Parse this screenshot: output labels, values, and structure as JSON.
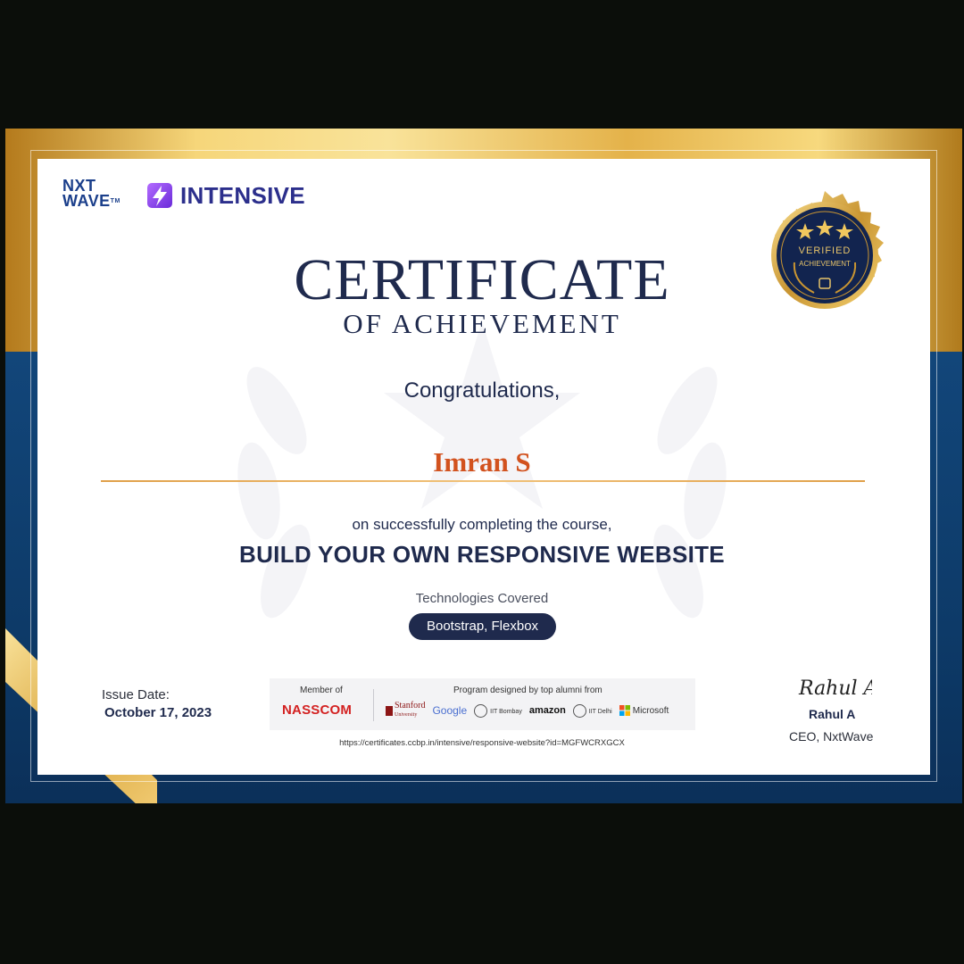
{
  "brand": {
    "nxt": "NXT",
    "wave": "WAVE",
    "tm": "TM",
    "program": "INTENSIVE"
  },
  "badge": {
    "line1": "VERIFIED",
    "line2": "ACHIEVEMENT"
  },
  "certificate": {
    "title": "CERTIFICATE",
    "subtitle": "OF ACHIEVEMENT",
    "greeting": "Congratulations,",
    "recipient": "Imran S",
    "completion_text": "on successfully completing the course,",
    "course": "BUILD YOUR OWN RESPONSIVE WEBSITE",
    "tech_label": "Technologies Covered",
    "technologies": "Bootstrap, Flexbox"
  },
  "issue": {
    "label": "Issue Date:",
    "date": "October 17, 2023"
  },
  "partners": {
    "member_label": "Member of",
    "member": "NASSCOM",
    "designed_label": "Program designed by top alumni from",
    "stanford": "Stanford",
    "stanford_sub": "University",
    "google": "Google",
    "iit_bombay": "IIT Bombay",
    "amazon": "amazon",
    "iit_delhi": "IIT Delhi",
    "microsoft": "Microsoft"
  },
  "verify_url": "https://certificates.ccbp.in/intensive/responsive-website?id=MGFWCRXGCX",
  "signatory": {
    "signature": "Rahul A",
    "name": "Rahul A",
    "role": "CEO, NxtWave"
  },
  "colors": {
    "navy": "#1f2a4d",
    "accent_orange": "#d2521e",
    "gold": "#e4b24a",
    "blue_band": "#12467a"
  }
}
